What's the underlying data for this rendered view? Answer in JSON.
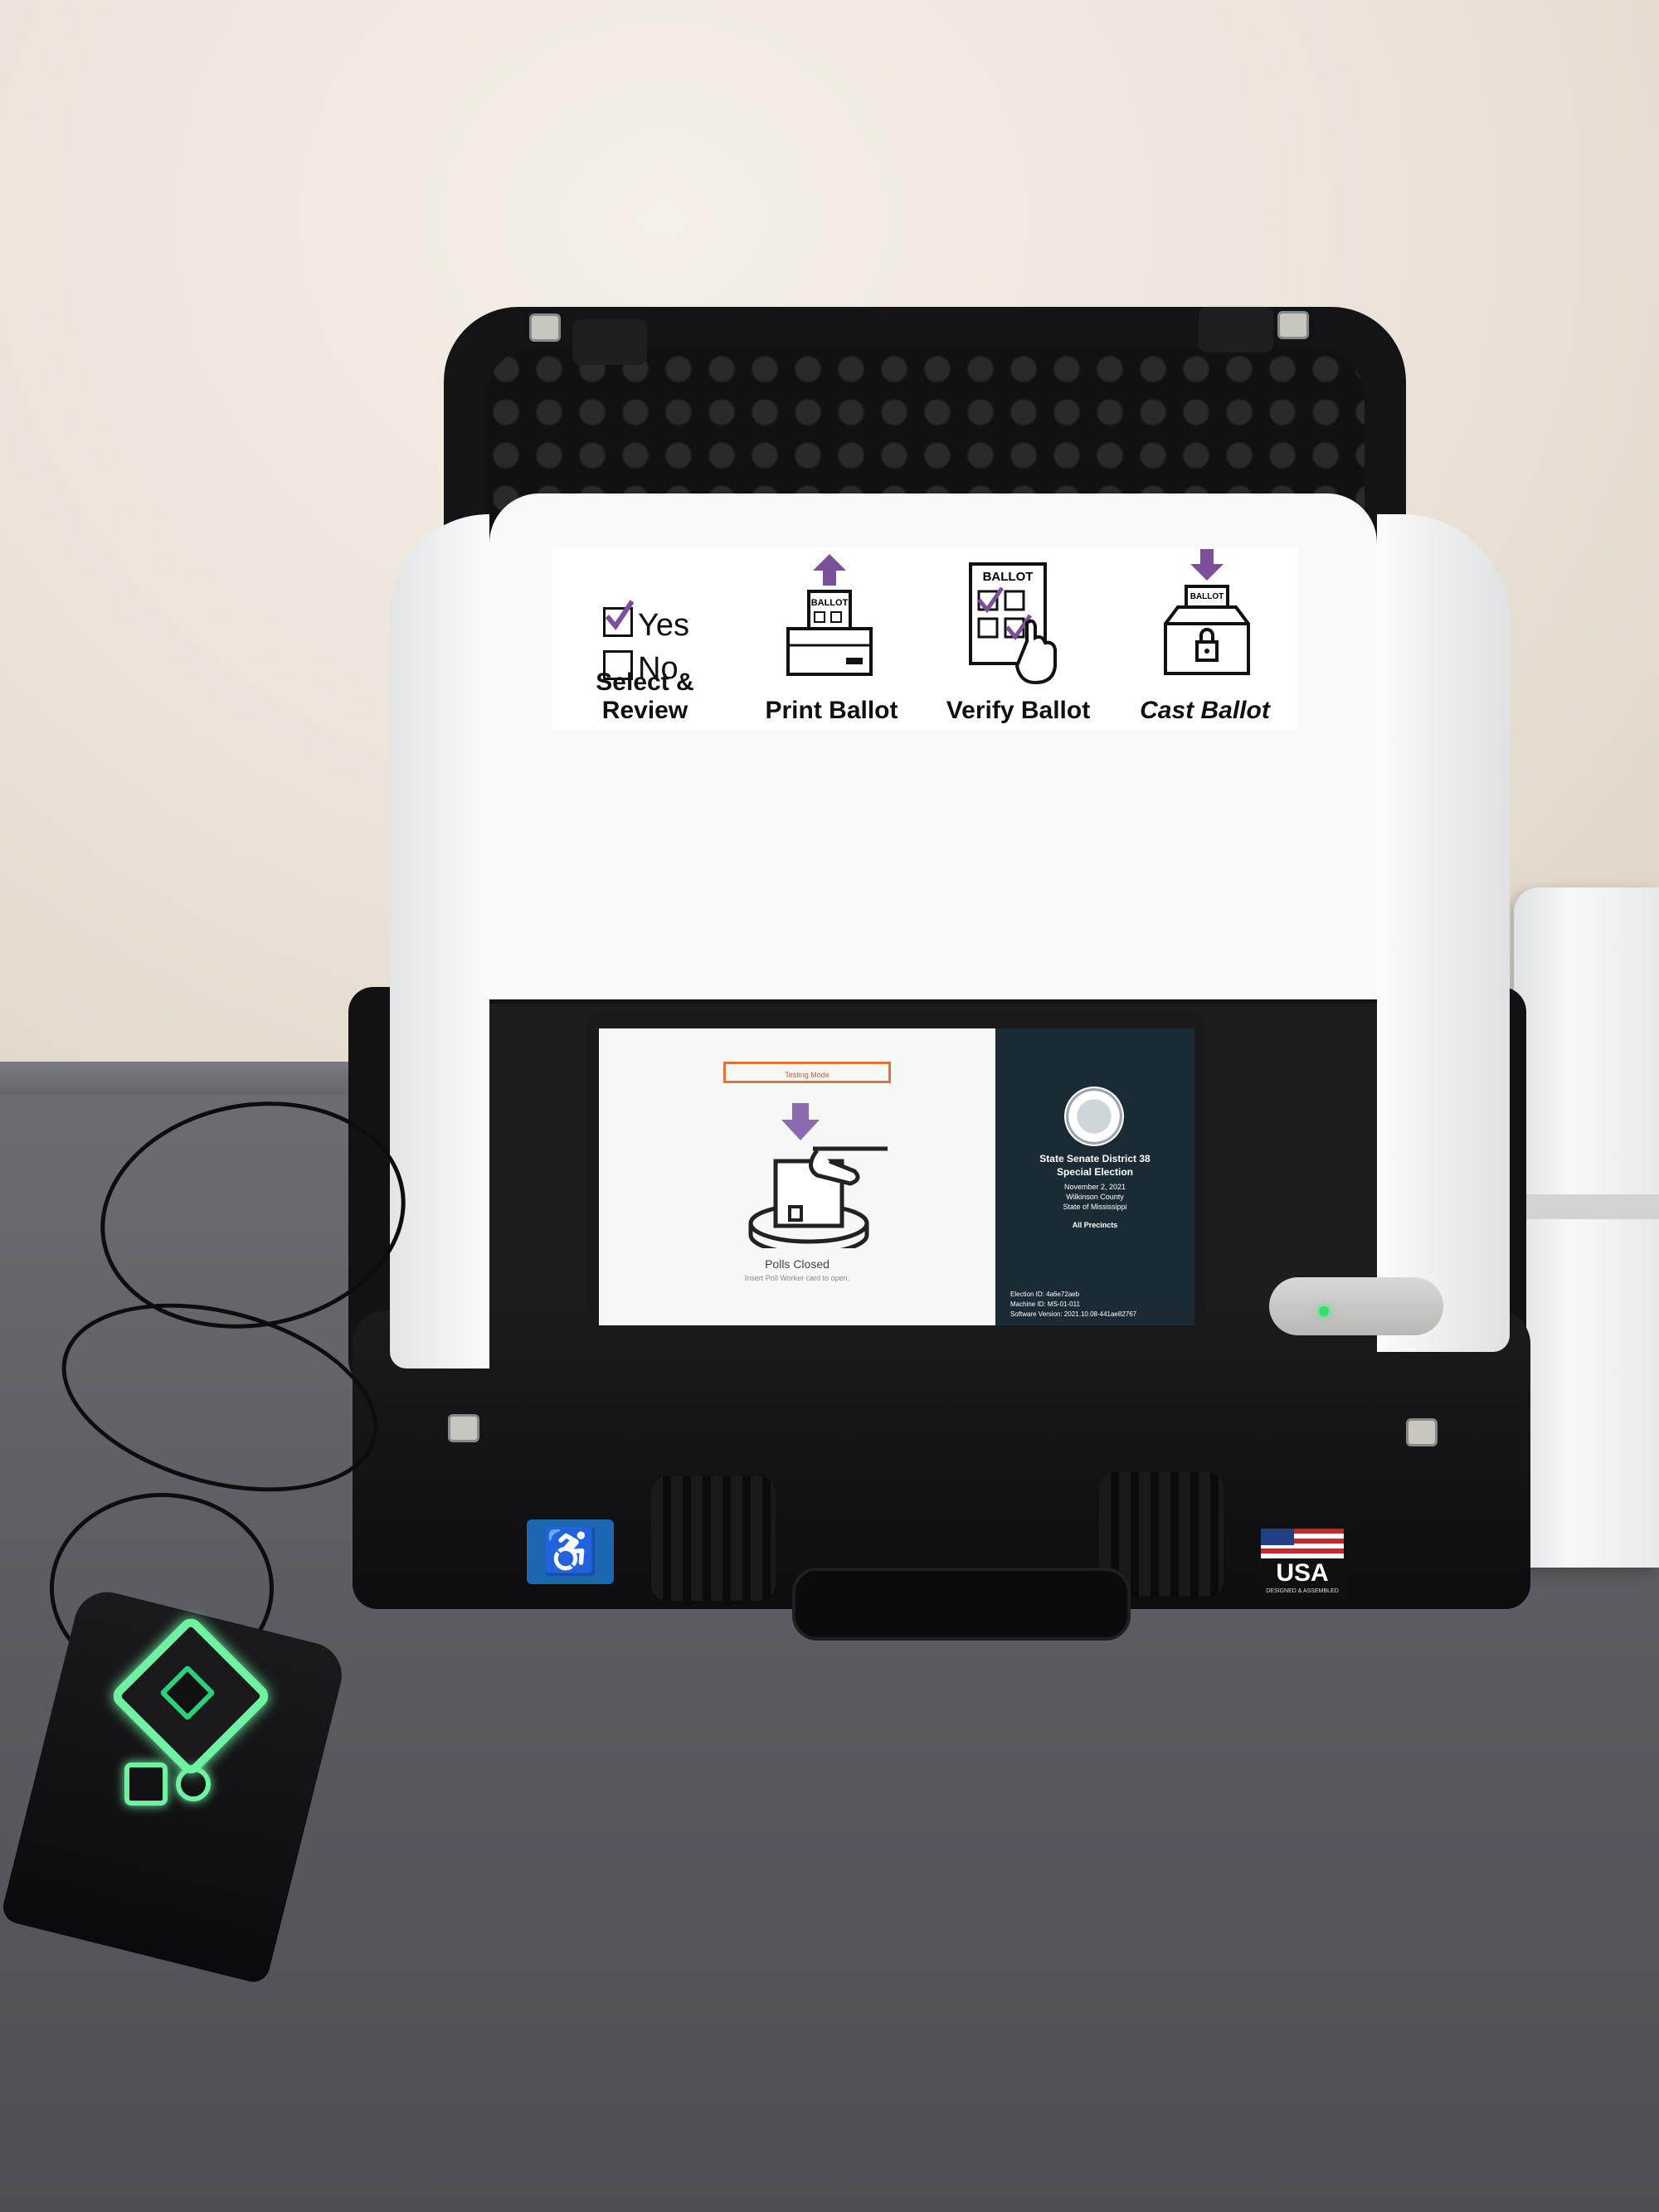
{
  "privacy_screen": {
    "steps": [
      {
        "label": "Select & Review",
        "icon": "yes-no-checkbox-icon"
      },
      {
        "label": "Print Ballot",
        "icon": "print-ballot-icon"
      },
      {
        "label": "Verify Ballot",
        "icon": "verify-ballot-icon"
      },
      {
        "label": "Cast Ballot",
        "icon": "cast-ballot-icon"
      }
    ],
    "yes_label": "Yes",
    "no_label": "No",
    "ballot_word": "BALLOT",
    "accent_color": "#7b4f9a"
  },
  "tablet": {
    "mode_badge": "Testing Mode",
    "status_title": "Polls Closed",
    "status_subtitle": "Insert Poll Worker card to open.",
    "election": {
      "title_line1": "State Senate District 38",
      "title_line2": "Special Election",
      "date": "November 2, 2021",
      "county": "Wilkinson County",
      "state": "State of Mississippi",
      "precincts": "All Precincts"
    },
    "footer": {
      "election_id": "Election ID: 4a6e72aeb",
      "machine_id": "Machine ID: MS-01-011",
      "software_version": "Software Version: 2021.10.08-441ae82767"
    }
  },
  "case": {
    "access_sticker_icon": "accessibility-icon",
    "country_label": "USA",
    "country_sub": "DESIGNED & ASSEMBLED"
  },
  "colors": {
    "controller_glow": "#6ff0a2",
    "reader_led": "#2be36a",
    "testing_badge": "#e0733a",
    "tablet_right_panel": "#1b2b36"
  }
}
